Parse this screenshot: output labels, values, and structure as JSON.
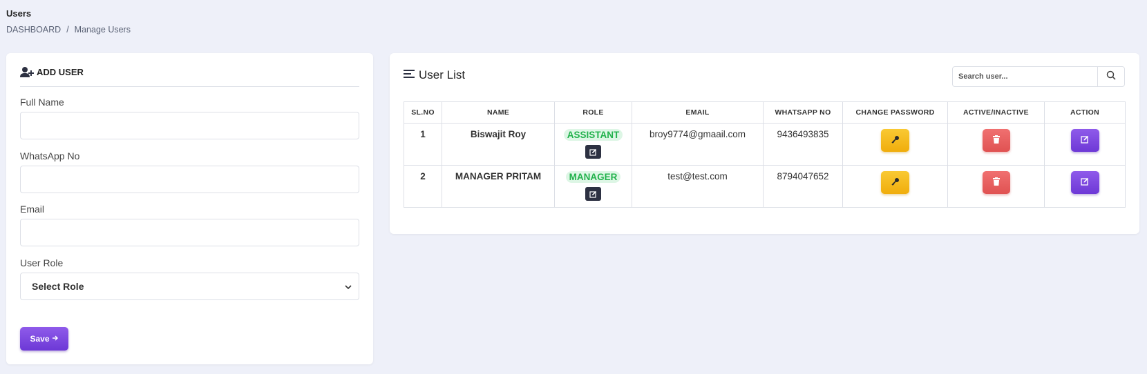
{
  "page": {
    "title": "Users",
    "breadcrumb": [
      {
        "label": "DASHBOARD"
      },
      {
        "label": "Manage Users"
      }
    ]
  },
  "add_user": {
    "heading": "ADD USER",
    "fields": {
      "full_name_label": "Full Name",
      "whatsapp_label": "WhatsApp No",
      "email_label": "Email",
      "role_label": "User Role",
      "role_selected": "Select Role"
    },
    "save_label": "Save"
  },
  "user_list": {
    "heading": "User List",
    "search_placeholder": "Search user...",
    "columns": [
      "SL.NO",
      "NAME",
      "ROLE",
      "EMAIL",
      "WHATSAPP NO",
      "CHANGE PASSWORD",
      "ACTIVE/INACTIVE",
      "ACTION"
    ],
    "rows": [
      {
        "sl": "1",
        "name": "Biswajit Roy",
        "role": "ASSISTANT",
        "email": "broy9774@gmaail.com",
        "whatsapp": "9436493835"
      },
      {
        "sl": "2",
        "name": "MANAGER PRITAM",
        "role": "MANAGER",
        "email": "test@test.com",
        "whatsapp": "8794047652"
      }
    ]
  },
  "colors": {
    "background": "#eef0f9",
    "primary": "#7c4ae0",
    "warning": "#f5bc1f",
    "danger": "#e85f5f",
    "success_text": "#22b24c",
    "success_bg": "#ddf6e5",
    "dark": "#2d3142"
  },
  "icons": {
    "add_user": "user-plus-icon",
    "list": "list-icon",
    "search": "search-icon",
    "key": "key-icon",
    "trash": "trash-icon",
    "edit": "edit-icon",
    "chevron": "chevron-down-icon",
    "arrow": "arrow-right-icon"
  }
}
